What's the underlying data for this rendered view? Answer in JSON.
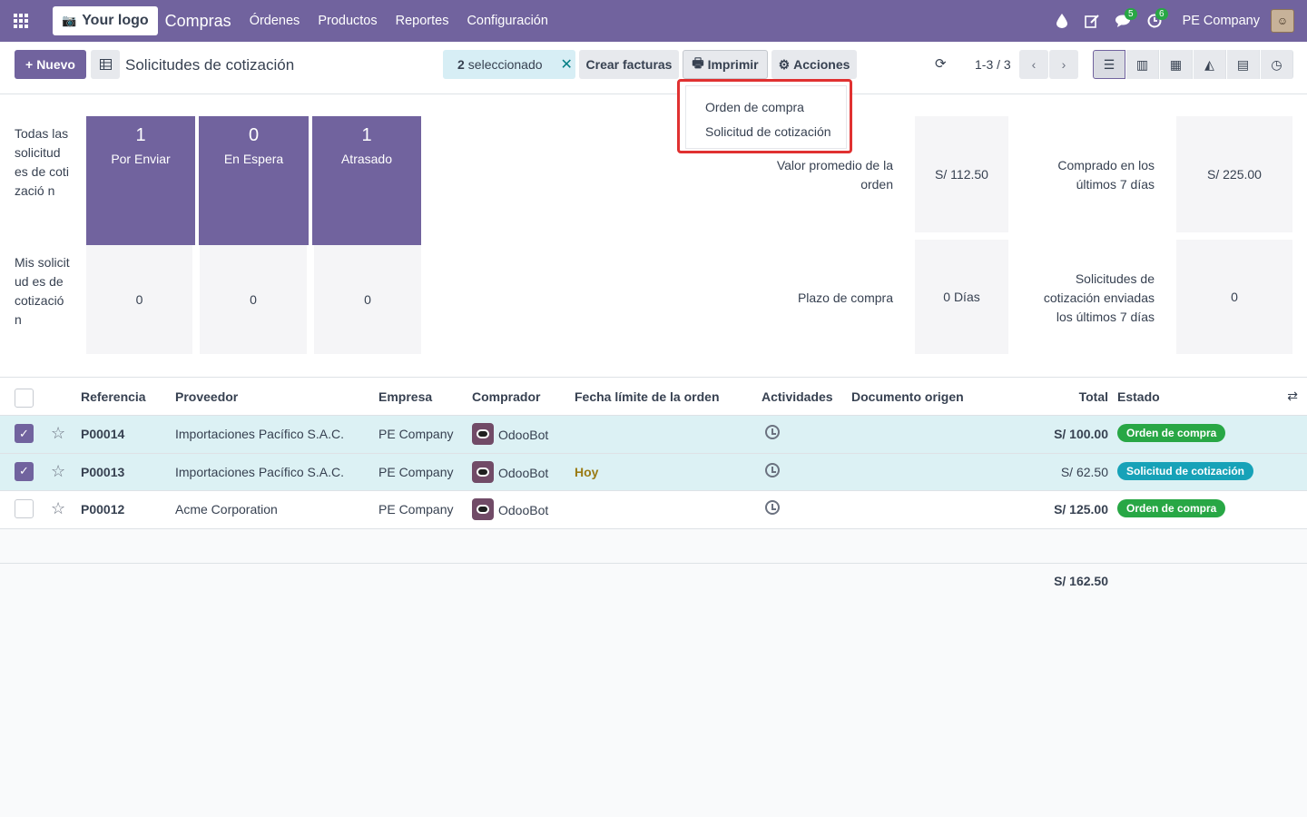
{
  "navbar": {
    "logo_text": "Your logo",
    "app_name": "Compras",
    "menu": [
      "Órdenes",
      "Productos",
      "Reportes",
      "Configuración"
    ],
    "chat_count": "5",
    "activity_count": "6",
    "company": "PE Company"
  },
  "control": {
    "new_label": "Nuevo",
    "breadcrumb": "Solicitudes de cotización",
    "selected_count": "2",
    "selected_label": "seleccionado",
    "create_invoices": "Crear facturas",
    "print": "Imprimir",
    "actions": "Acciones",
    "pager": "1-3 / 3"
  },
  "print_menu": {
    "items": [
      "Orden de compra",
      "Solicitud de cotización"
    ]
  },
  "dashboard": {
    "row1_label": "Todas las solicitud es de cotizació n",
    "row2_label": "Mis solicitud es de cotizació n",
    "tiles": [
      {
        "num": "1",
        "label": "Por Enviar"
      },
      {
        "num": "0",
        "label": "En Espera"
      },
      {
        "num": "1",
        "label": "Atrasado"
      }
    ],
    "mine": [
      "0",
      "0",
      "0"
    ],
    "kpis": [
      {
        "label": "Valor promedio de la orden",
        "value": "S/ 112.50"
      },
      {
        "label": "Comprado en los últimos 7 días",
        "value": "S/ 225.00"
      },
      {
        "label": "Plazo de compra",
        "value": "0 Días"
      },
      {
        "label": "Solicitudes de cotización enviadas los últimos 7 días",
        "value": "0"
      }
    ]
  },
  "table": {
    "headers": {
      "ref": "Referencia",
      "vendor": "Proveedor",
      "company": "Empresa",
      "buyer": "Comprador",
      "deadline": "Fecha límite de la orden",
      "activities": "Actividades",
      "origin": "Documento origen",
      "total": "Total",
      "state": "Estado"
    },
    "rows": [
      {
        "ref": "P00014",
        "vendor": "Importaciones Pacífico S.A.C.",
        "company": "PE Company",
        "buyer": "OdooBot",
        "deadline": "",
        "total": "S/ 100.00",
        "state": "Orden de compra",
        "selected": true
      },
      {
        "ref": "P00013",
        "vendor": "Importaciones Pacífico S.A.C.",
        "company": "PE Company",
        "buyer": "OdooBot",
        "deadline": "Hoy",
        "total": "S/ 62.50",
        "state": "Solicitud de cotización",
        "selected": true
      },
      {
        "ref": "P00012",
        "vendor": "Acme Corporation",
        "company": "PE Company",
        "buyer": "OdooBot",
        "deadline": "",
        "total": "S/ 125.00",
        "state": "Orden de compra",
        "selected": false
      }
    ],
    "grand_total": "S/ 162.50"
  },
  "colors": {
    "brand": "#71639e",
    "selected_row": "#dcf1f4",
    "badge_green": "#28a745",
    "badge_teal": "#17a2b8",
    "highlight_border": "#e03131",
    "deadline_today": "#9a7b14"
  }
}
